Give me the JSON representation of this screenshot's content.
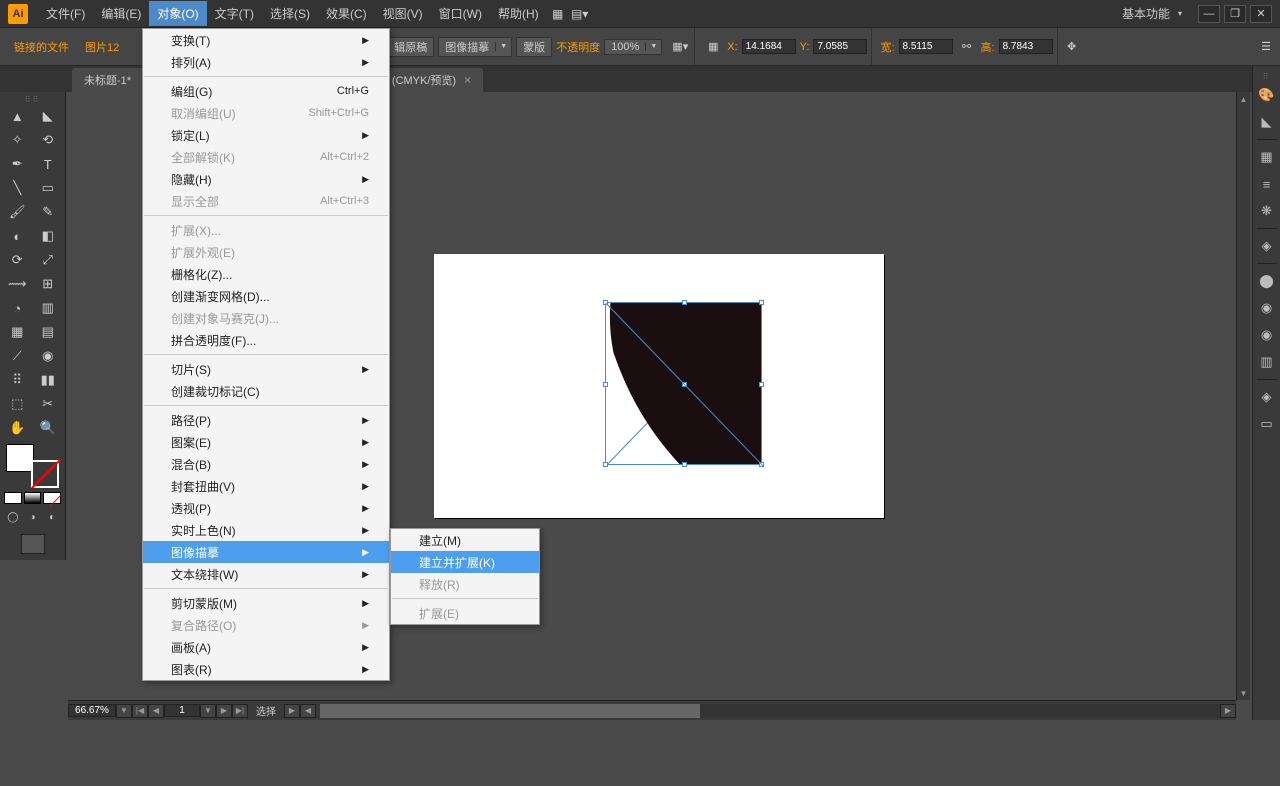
{
  "menubar": {
    "items": [
      "文件(F)",
      "编辑(E)",
      "对象(O)",
      "文字(T)",
      "选择(S)",
      "效果(C)",
      "视图(V)",
      "窗口(W)",
      "帮助(H)"
    ],
    "active_index": 2,
    "workspace": "基本功能"
  },
  "control_bar": {
    "linked_files": "链接的文件",
    "image_tab": "图片12",
    "edit_original": "辑原稿",
    "image_trace": "图像描摹",
    "mask": "蒙版",
    "opacity_label": "不透明度",
    "opacity_value": "100%",
    "x_label": "X:",
    "x_value": "14.1684",
    "y_label": "Y:",
    "y_value": "7.0585",
    "w_label": "宽:",
    "w_value": "8.5115",
    "h_label": "高:",
    "h_value": "8.7843"
  },
  "document": {
    "tab_title": "未标题-1*",
    "tab_suffix": "% (CMYK/预览)"
  },
  "dropdown": {
    "items": [
      {
        "label": "变换(T)",
        "arrow": true
      },
      {
        "label": "排列(A)",
        "arrow": true
      },
      {
        "sep": true
      },
      {
        "label": "编组(G)",
        "shortcut": "Ctrl+G"
      },
      {
        "label": "取消编组(U)",
        "shortcut": "Shift+Ctrl+G",
        "disabled": true
      },
      {
        "label": "锁定(L)",
        "arrow": true
      },
      {
        "label": "全部解锁(K)",
        "shortcut": "Alt+Ctrl+2",
        "disabled": true
      },
      {
        "label": "隐藏(H)",
        "arrow": true
      },
      {
        "label": "显示全部",
        "shortcut": "Alt+Ctrl+3",
        "disabled": true
      },
      {
        "sep": true
      },
      {
        "label": "扩展(X)...",
        "disabled": true
      },
      {
        "label": "扩展外观(E)",
        "disabled": true
      },
      {
        "label": "栅格化(Z)..."
      },
      {
        "label": "创建渐变网格(D)..."
      },
      {
        "label": "创建对象马赛克(J)...",
        "disabled": true
      },
      {
        "label": "拼合透明度(F)..."
      },
      {
        "sep": true
      },
      {
        "label": "切片(S)",
        "arrow": true
      },
      {
        "label": "创建裁切标记(C)"
      },
      {
        "sep": true
      },
      {
        "label": "路径(P)",
        "arrow": true
      },
      {
        "label": "图案(E)",
        "arrow": true
      },
      {
        "label": "混合(B)",
        "arrow": true
      },
      {
        "label": "封套扭曲(V)",
        "arrow": true
      },
      {
        "label": "透视(P)",
        "arrow": true
      },
      {
        "label": "实时上色(N)",
        "arrow": true
      },
      {
        "label": "图像描摹",
        "arrow": true,
        "highlighted": true
      },
      {
        "label": "文本绕排(W)",
        "arrow": true
      },
      {
        "sep": true
      },
      {
        "label": "剪切蒙版(M)",
        "arrow": true
      },
      {
        "label": "复合路径(O)",
        "arrow": true,
        "disabled": true
      },
      {
        "label": "画板(A)",
        "arrow": true
      },
      {
        "label": "图表(R)",
        "arrow": true
      }
    ]
  },
  "submenu": {
    "items": [
      {
        "label": "建立(M)"
      },
      {
        "label": "建立并扩展(K)",
        "highlighted": true
      },
      {
        "label": "释放(R)",
        "disabled": true
      },
      {
        "sep": true
      },
      {
        "label": "扩展(E)",
        "disabled": true
      }
    ]
  },
  "status_bar": {
    "zoom": "66.67%",
    "page_input": "1",
    "status_text": "选择"
  }
}
